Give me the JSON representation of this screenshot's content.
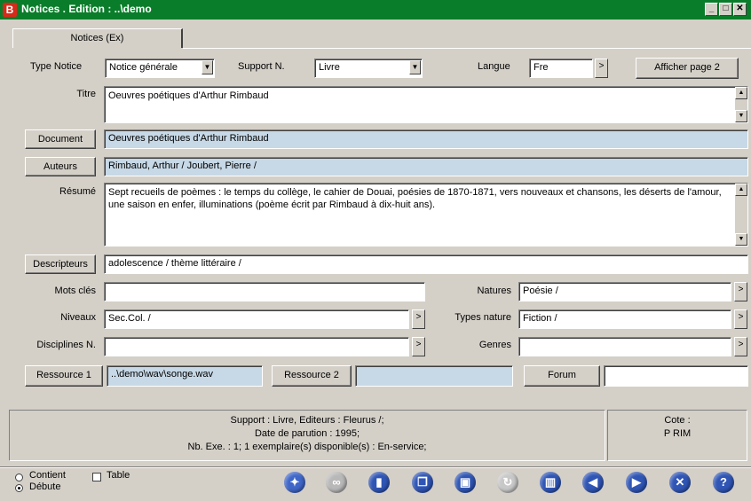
{
  "window": {
    "title": "Notices . Edition  : ..\\demo",
    "icon_letter": "B"
  },
  "tab": {
    "label": "Notices (Ex)"
  },
  "form": {
    "type_notice": {
      "label": "Type Notice",
      "value": "Notice générale"
    },
    "support": {
      "label": "Support N.",
      "value": "Livre"
    },
    "langue": {
      "label": "Langue",
      "value": "Fre"
    },
    "afficher_page2": "Afficher page 2",
    "titre": {
      "label": "Titre",
      "value": "Oeuvres poétiques d'Arthur Rimbaud"
    },
    "document": {
      "button": "Document",
      "value": "Oeuvres poétiques d'Arthur Rimbaud"
    },
    "auteurs": {
      "button": "Auteurs",
      "value": "Rimbaud, Arthur / Joubert, Pierre /"
    },
    "resume": {
      "label": "Résumé",
      "value": "Sept recueils de poèmes : le temps du collège, le cahier de Douai, poésies de 1870-1871, vers nouveaux et chansons, les déserts de l'amour, une saison en enfer, illuminations (poème écrit par Rimbaud à dix-huit ans)."
    },
    "descripteurs": {
      "button": "Descripteurs",
      "value": "adolescence / thème littéraire /"
    },
    "mots_cles": {
      "label": "Mots clés",
      "value": ""
    },
    "natures": {
      "label": "Natures",
      "value": "Poésie /"
    },
    "niveaux": {
      "label": "Niveaux",
      "value": "Sec.Col. /"
    },
    "types_nature": {
      "label": "Types nature",
      "value": "Fiction /"
    },
    "disciplines": {
      "label": "Disciplines N.",
      "value": ""
    },
    "genres": {
      "label": "Genres",
      "value": ""
    },
    "ressource1": {
      "button": "Ressource 1",
      "value": "..\\demo\\wav\\songe.wav"
    },
    "ressource2": {
      "button": "Ressource 2",
      "value": ""
    },
    "forum": {
      "button": "Forum",
      "value": ""
    }
  },
  "status": {
    "line1": "Support : Livre,  Editeurs : Fleurus /;",
    "line2": "Date de parution  : 1995;",
    "line3": "Nb. Exe. : 1; 1 exemplaire(s) disponible(s)  :  En-service;",
    "cote_label": "Cote :",
    "cote_value": "P RIM"
  },
  "footer": {
    "radio_contient": "Contient",
    "radio_debute": "Débute",
    "check_table": "Table"
  },
  "toolbar_icons": [
    {
      "name": "search-icon",
      "glyph": "✦",
      "color": "#3f67c9"
    },
    {
      "name": "link-icon",
      "glyph": "∞",
      "color": "#b8b8b8"
    },
    {
      "name": "book-icon",
      "glyph": "▮",
      "color": "#2f55b5"
    },
    {
      "name": "copy-icon",
      "glyph": "❐",
      "color": "#2f55b5"
    },
    {
      "name": "save-icon",
      "glyph": "▣",
      "color": "#2f55b5"
    },
    {
      "name": "refresh-icon",
      "glyph": "↻",
      "color": "#c8c8c8"
    },
    {
      "name": "delete-icon",
      "glyph": "▥",
      "color": "#2f55b5"
    },
    {
      "name": "previous-icon",
      "glyph": "◀",
      "color": "#2f55b5"
    },
    {
      "name": "next-icon",
      "glyph": "▶",
      "color": "#2f55b5"
    },
    {
      "name": "close-icon",
      "glyph": "✕",
      "color": "#2f55b5"
    },
    {
      "name": "help-icon",
      "glyph": "?",
      "color": "#2f55b5"
    }
  ]
}
